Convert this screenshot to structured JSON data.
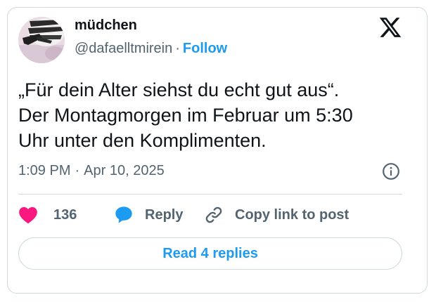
{
  "author": {
    "name": "müdchen",
    "handle": "@dafaelltmirein",
    "separator": "·",
    "follow_label": "Follow"
  },
  "tweet": {
    "lines": [
      "„Für dein Alter siehst du echt gut aus“.",
      "Der Montagmorgen im Februar um 5:30",
      "Uhr unter den Komplimenten."
    ],
    "time": "1:09 PM",
    "separator": "·",
    "date": "Apr 10, 2025"
  },
  "actions": {
    "like_count": "136",
    "reply_label": "Reply",
    "copy_label": "Copy link to post"
  },
  "footer": {
    "read_replies_label": "Read 4 replies"
  },
  "icons": {
    "brand": "x-logo-icon",
    "info": "info-icon",
    "like": "heart-icon",
    "reply": "speech-bubble-icon",
    "copy": "link-icon"
  },
  "colors": {
    "accent": "#1d9bf0",
    "heart": "#f91880",
    "secondary_text": "#536471",
    "border": "#cfd9de"
  }
}
